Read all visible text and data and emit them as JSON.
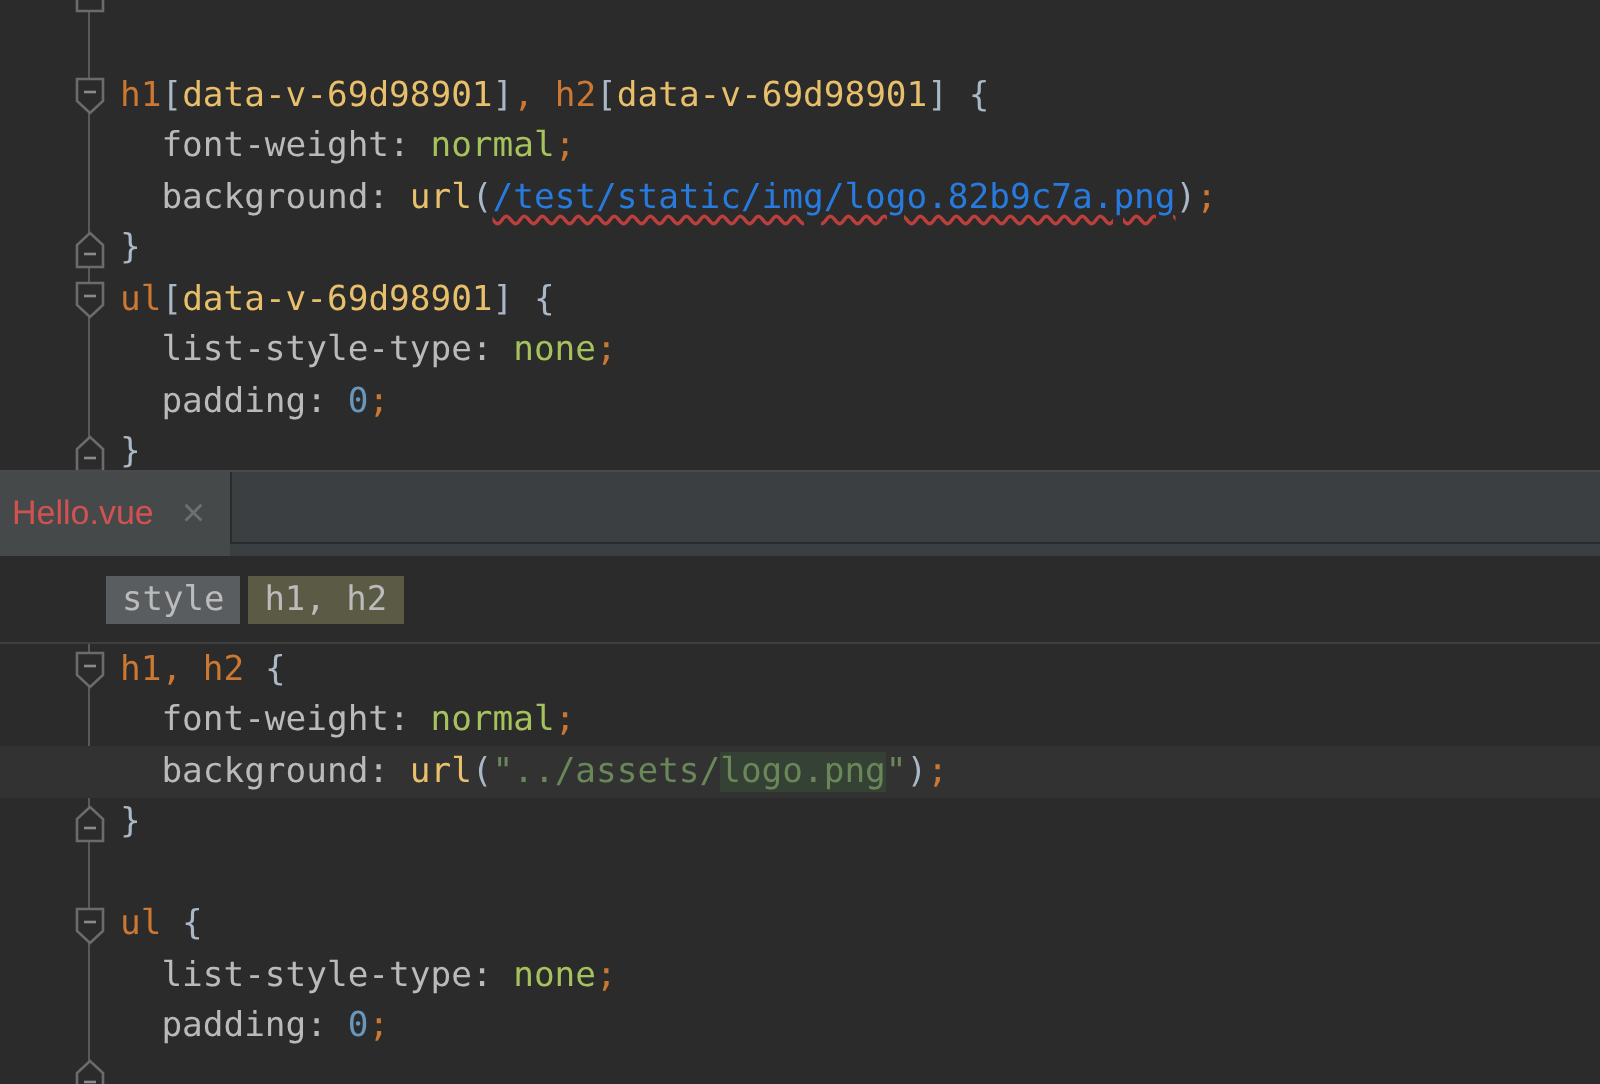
{
  "top_pane": {
    "lines": [
      {
        "kind": "blank",
        "fold_start": false,
        "fold_end": true
      },
      {
        "kind": "blank",
        "fold_start": false,
        "fold_end": false
      },
      {
        "kind": "code",
        "fold_start": true,
        "fold_end": false,
        "tokens": [
          {
            "kind": "tag",
            "text": "h1"
          },
          {
            "kind": "punct",
            "text": "["
          },
          {
            "kind": "attr",
            "text": "data-v-69d98901"
          },
          {
            "kind": "punct",
            "text": "]"
          },
          {
            "kind": "semi",
            "text": ", "
          },
          {
            "kind": "tag",
            "text": "h2"
          },
          {
            "kind": "punct",
            "text": "["
          },
          {
            "kind": "attr",
            "text": "data-v-69d98901"
          },
          {
            "kind": "punct",
            "text": "] {"
          }
        ]
      },
      {
        "kind": "code",
        "fold_start": false,
        "fold_end": false,
        "tokens": [
          {
            "kind": "prop",
            "text": "  font-weight: "
          },
          {
            "kind": "value",
            "text": "normal"
          },
          {
            "kind": "semi",
            "text": ";"
          }
        ]
      },
      {
        "kind": "code",
        "fold_start": false,
        "fold_end": false,
        "tokens": [
          {
            "kind": "prop",
            "text": "  background: "
          },
          {
            "kind": "func",
            "text": "url"
          },
          {
            "kind": "punct",
            "text": "("
          },
          {
            "kind": "url-error",
            "text": "/test/static/img/logo.82b9c7a.png"
          },
          {
            "kind": "punct",
            "text": ")"
          },
          {
            "kind": "semi",
            "text": ";"
          }
        ]
      },
      {
        "kind": "code",
        "fold_start": false,
        "fold_end": true,
        "tokens": [
          {
            "kind": "punct",
            "text": "}"
          }
        ]
      },
      {
        "kind": "code",
        "fold_start": true,
        "fold_end": false,
        "tokens": [
          {
            "kind": "tag",
            "text": "ul"
          },
          {
            "kind": "punct",
            "text": "["
          },
          {
            "kind": "attr",
            "text": "data-v-69d98901"
          },
          {
            "kind": "punct",
            "text": "] {"
          }
        ]
      },
      {
        "kind": "code",
        "fold_start": false,
        "fold_end": false,
        "tokens": [
          {
            "kind": "prop",
            "text": "  list-style-type: "
          },
          {
            "kind": "value",
            "text": "none"
          },
          {
            "kind": "semi",
            "text": ";"
          }
        ]
      },
      {
        "kind": "code",
        "fold_start": false,
        "fold_end": false,
        "tokens": [
          {
            "kind": "prop",
            "text": "  padding: "
          },
          {
            "kind": "number",
            "text": "0"
          },
          {
            "kind": "semi",
            "text": ";"
          }
        ]
      },
      {
        "kind": "code",
        "fold_start": false,
        "fold_end": true,
        "tokens": [
          {
            "kind": "punct",
            "text": "}"
          }
        ]
      }
    ]
  },
  "tabs": [
    {
      "label": "Hello.vue",
      "close": "×",
      "selected": true
    }
  ],
  "breadcrumbs": [
    {
      "label": "style",
      "selected": false
    },
    {
      "label": "h1, h2",
      "selected": true
    }
  ],
  "bottom_pane": {
    "lines": [
      {
        "kind": "code",
        "current": false,
        "fold_start": true,
        "fold_end": false,
        "tokens": [
          {
            "kind": "tag",
            "text": "h1"
          },
          {
            "kind": "semi",
            "text": ", "
          },
          {
            "kind": "tag",
            "text": "h2"
          },
          {
            "kind": "punct",
            "text": " {"
          }
        ]
      },
      {
        "kind": "code",
        "current": false,
        "fold_start": false,
        "fold_end": false,
        "tokens": [
          {
            "kind": "prop",
            "text": "  font-weight: "
          },
          {
            "kind": "value",
            "text": "normal"
          },
          {
            "kind": "semi",
            "text": ";"
          }
        ]
      },
      {
        "kind": "code",
        "current": true,
        "fold_start": false,
        "fold_end": false,
        "tokens": [
          {
            "kind": "prop",
            "text": "  background: "
          },
          {
            "kind": "func",
            "text": "url"
          },
          {
            "kind": "punct",
            "text": "("
          },
          {
            "kind": "string",
            "text": "\"../assets/"
          },
          {
            "kind": "string-match",
            "text": "logo.png"
          },
          {
            "kind": "string",
            "text": "\""
          },
          {
            "kind": "punct",
            "text": ")"
          },
          {
            "kind": "semi",
            "text": ";"
          }
        ]
      },
      {
        "kind": "code",
        "current": false,
        "fold_start": false,
        "fold_end": true,
        "tokens": [
          {
            "kind": "punct",
            "text": "}"
          }
        ]
      },
      {
        "kind": "blank",
        "current": false,
        "fold_start": false,
        "fold_end": false
      },
      {
        "kind": "code",
        "current": false,
        "fold_start": true,
        "fold_end": false,
        "tokens": [
          {
            "kind": "tag",
            "text": "ul"
          },
          {
            "kind": "punct",
            "text": " {"
          }
        ]
      },
      {
        "kind": "code",
        "current": false,
        "fold_start": false,
        "fold_end": false,
        "tokens": [
          {
            "kind": "prop",
            "text": "  list-style-type: "
          },
          {
            "kind": "value",
            "text": "none"
          },
          {
            "kind": "semi",
            "text": ";"
          }
        ]
      },
      {
        "kind": "code",
        "current": false,
        "fold_start": false,
        "fold_end": false,
        "tokens": [
          {
            "kind": "prop",
            "text": "  padding: "
          },
          {
            "kind": "number",
            "text": "0"
          },
          {
            "kind": "semi",
            "text": ";"
          }
        ]
      },
      {
        "kind": "blank",
        "current": false,
        "fold_start": false,
        "fold_end": true
      }
    ]
  }
}
